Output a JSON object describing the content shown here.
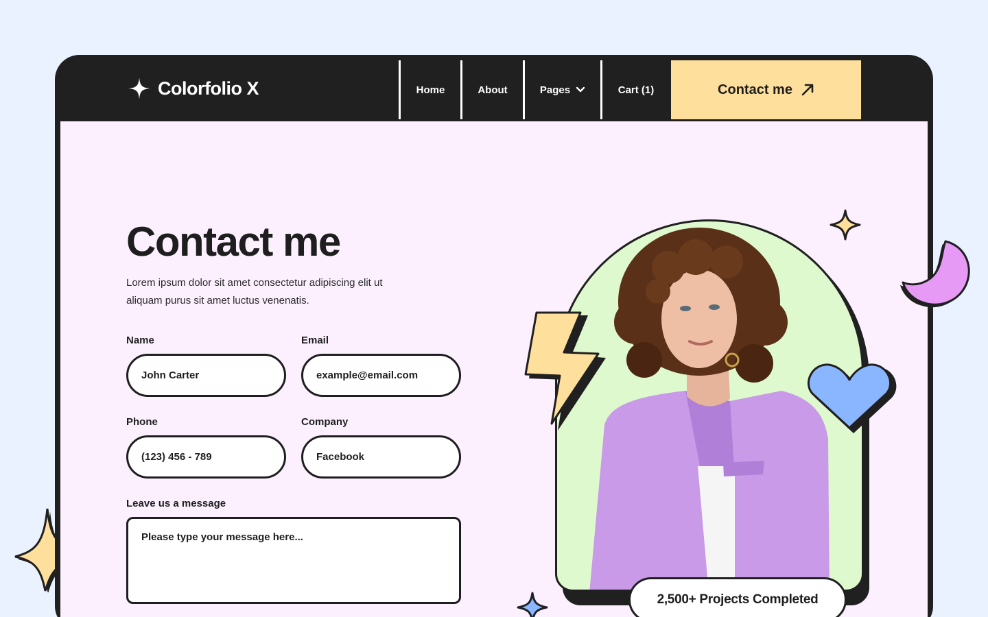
{
  "brand": {
    "name": "Colorfolio X"
  },
  "nav": {
    "home": "Home",
    "about": "About",
    "pages": "Pages",
    "cart": "Cart (1)",
    "cta": "Contact me"
  },
  "hero": {
    "title": "Contact me",
    "lead": "Lorem ipsum dolor sit amet consectetur adipiscing elit ut aliquam purus sit amet luctus venenatis."
  },
  "form": {
    "name": {
      "label": "Name",
      "value": "John Carter"
    },
    "email": {
      "label": "Email",
      "value": "example@email.com"
    },
    "phone": {
      "label": "Phone",
      "value": "(123) 456 - 789"
    },
    "company": {
      "label": "Company",
      "value": "Facebook"
    },
    "message": {
      "label": "Leave us a message",
      "placeholder": "Please type your message here..."
    }
  },
  "badge": {
    "text": "2,500+ Projects Completed"
  },
  "colors": {
    "background": "#ebf2ff",
    "frame": "#202020",
    "content": "#fcf0ff",
    "cta": "#ffdf9c",
    "arch": "#dff9cf",
    "blazer": "#c89ae8",
    "heart": "#8ab6ff",
    "moon": "#e79af5",
    "star": "#ffdf9c"
  },
  "icons": [
    "sparkle-logo-icon",
    "chevron-down-icon",
    "arrow-up-right-icon",
    "star-icon",
    "lightning-icon",
    "heart-icon",
    "moon-icon"
  ]
}
